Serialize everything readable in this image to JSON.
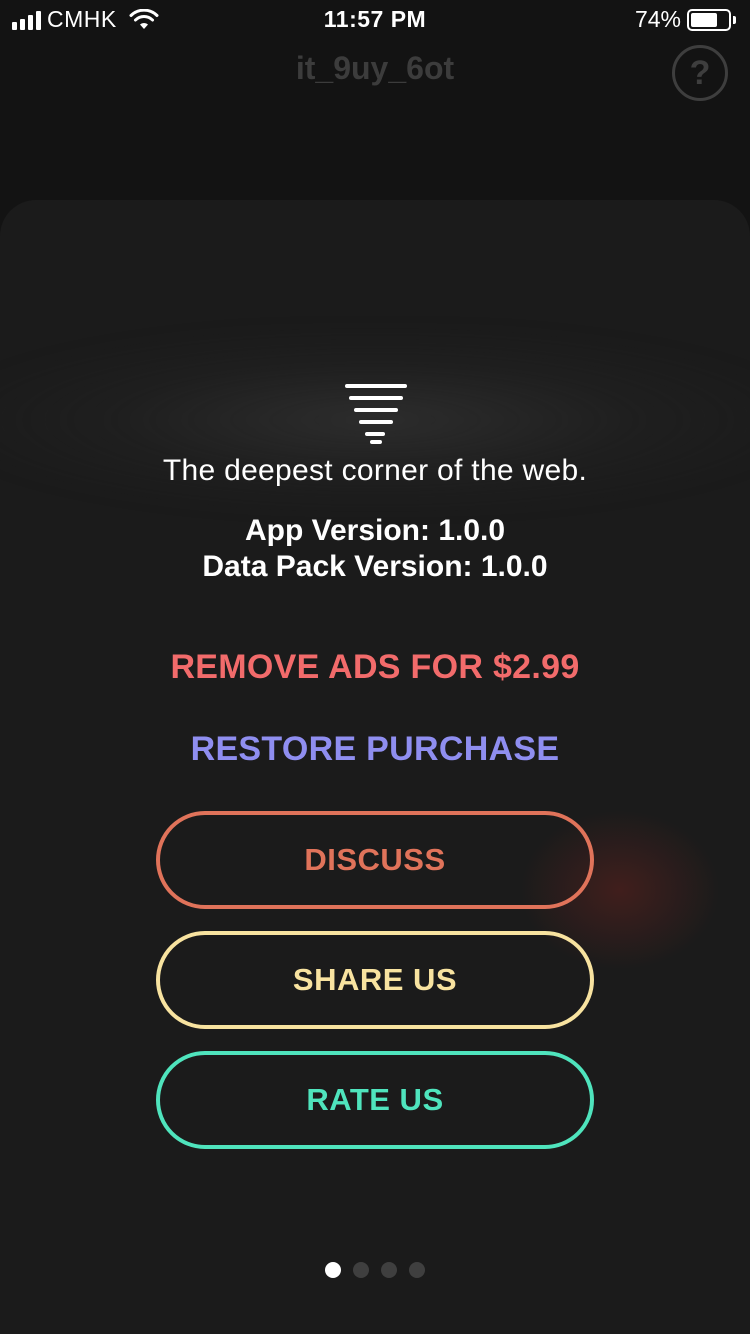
{
  "status_bar": {
    "carrier": "CMHK",
    "time": "11:57 PM",
    "battery_percent": "74%",
    "battery_level": 0.74
  },
  "nav": {
    "title": "it_9uy_6ot",
    "help_icon": "question-circle-icon",
    "help_glyph": "?"
  },
  "about": {
    "logo_icon": "tornado-lines-icon",
    "tagline": "The deepest corner of the web.",
    "app_version": "App Version: 1.0.0",
    "data_pack_version": "Data Pack Version: 1.0.0"
  },
  "actions": {
    "remove_ads": "REMOVE ADS FOR $2.99",
    "restore_purchase": "RESTORE PURCHASE",
    "discuss": "DISCUSS",
    "share_us": "SHARE US",
    "rate_us": "RATE US"
  },
  "colors": {
    "remove_ads": "#f26b6b",
    "restore_purchase": "#8f8ef0",
    "discuss": "#e0735a",
    "share_us": "#f8e3a0",
    "rate_us": "#4fe4bd"
  },
  "pagination": {
    "total": 4,
    "active_index": 0
  }
}
